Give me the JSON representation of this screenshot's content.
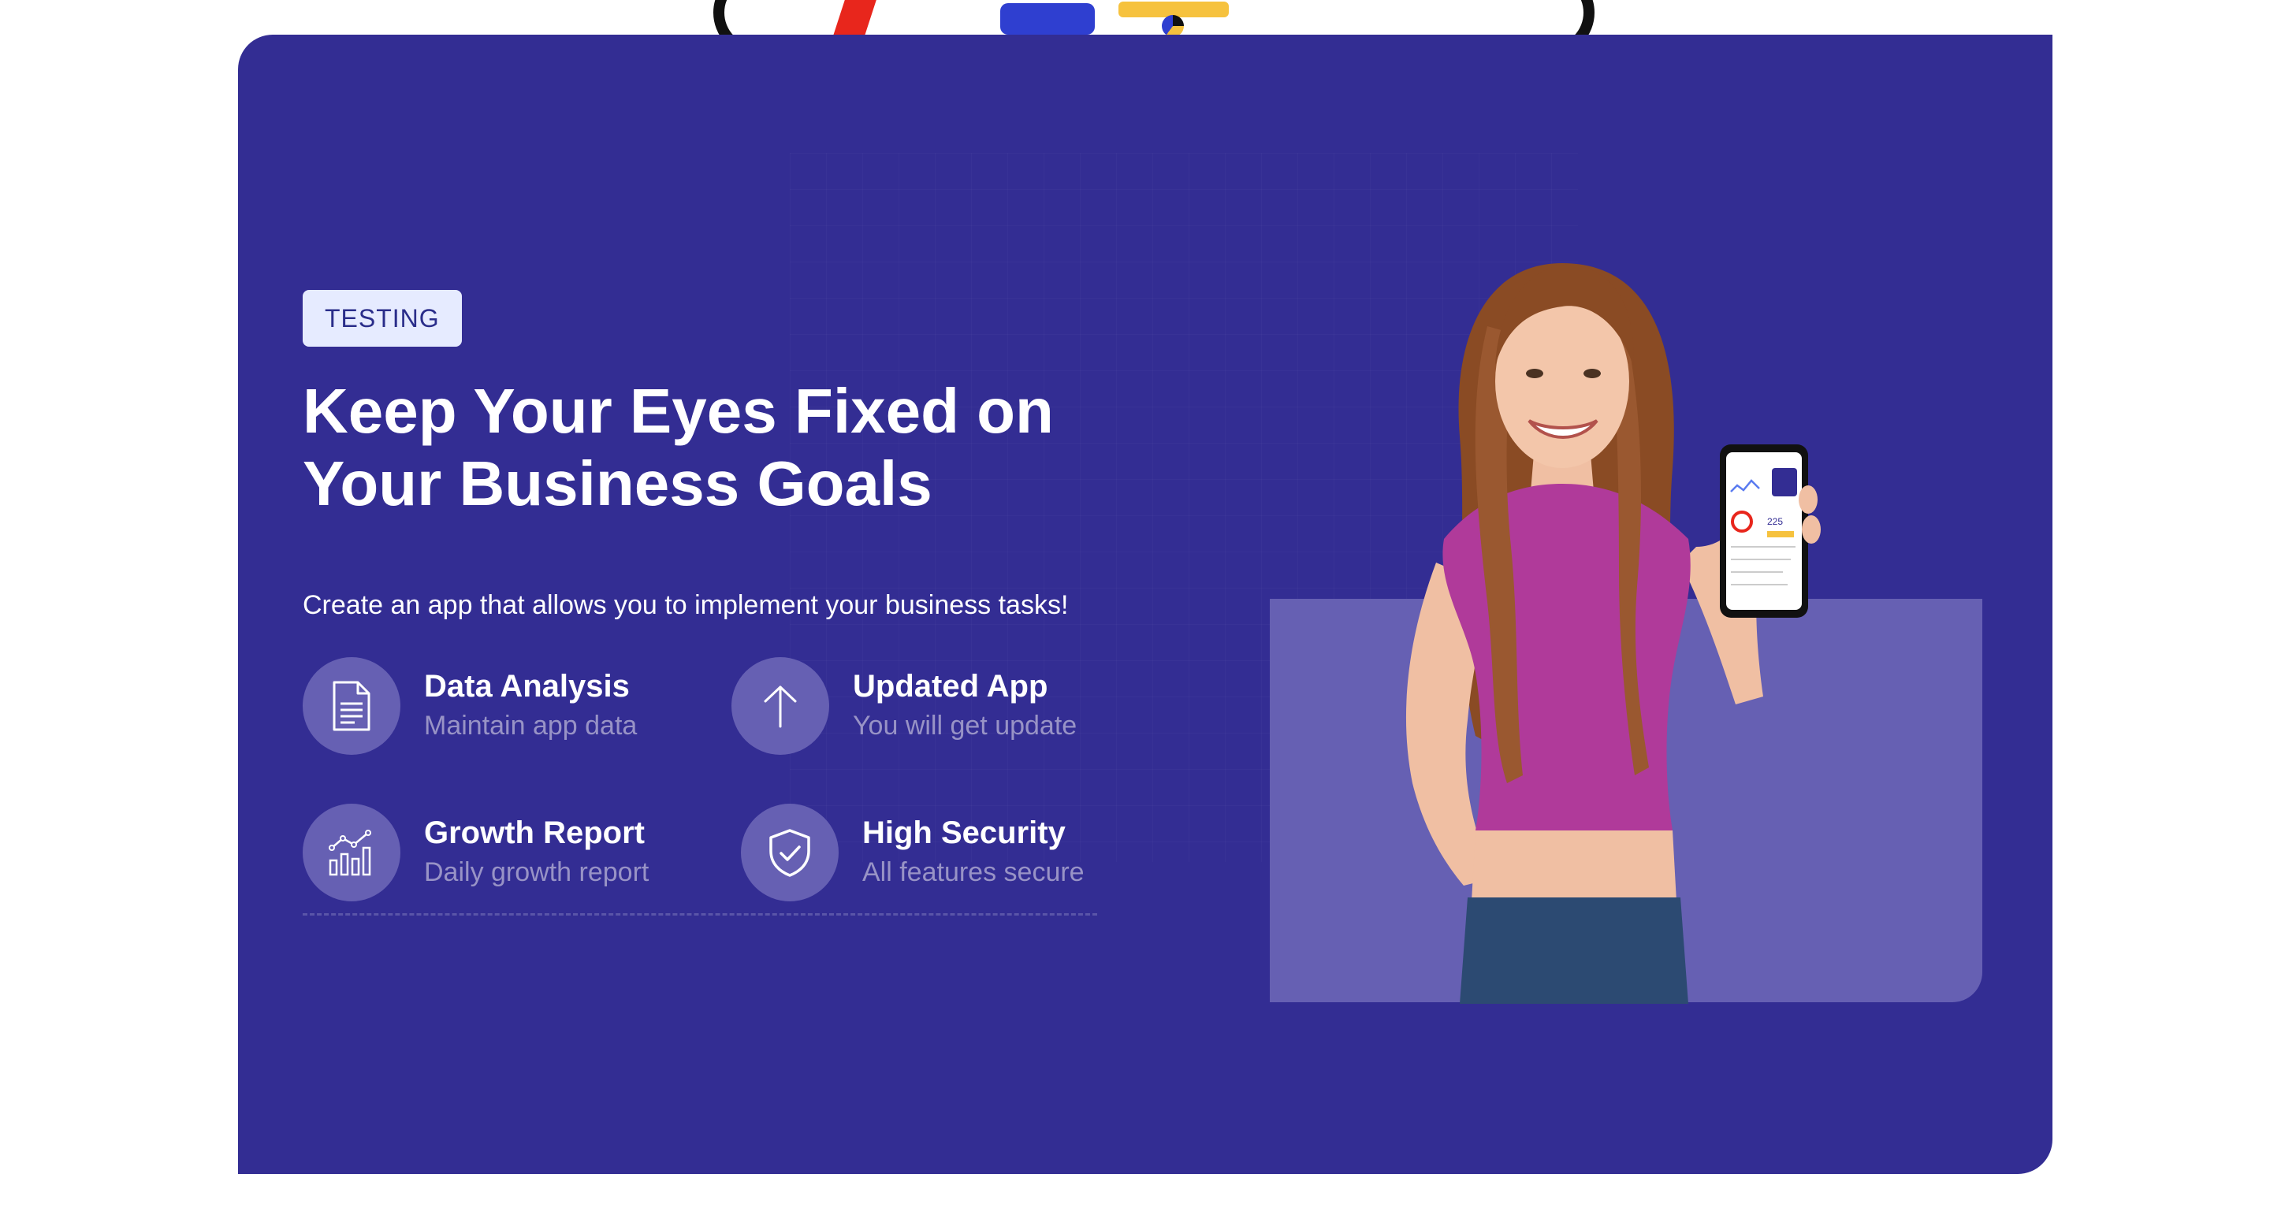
{
  "badge": {
    "label": "TESTING"
  },
  "hero": {
    "headline_line1": "Keep Your Eyes Fixed on",
    "headline_line2": "Your Business Goals",
    "subtext": "Create an app that allows you to implement your business tasks!"
  },
  "features": [
    {
      "title": "Data Analysis",
      "desc": "Maintain app data",
      "icon": "document-icon"
    },
    {
      "title": "Updated App",
      "desc": "You will get update",
      "icon": "arrow-up-icon"
    },
    {
      "title": "Growth Report",
      "desc": "Daily growth report",
      "icon": "growth-chart-icon"
    },
    {
      "title": "High Security",
      "desc": "All features secure",
      "icon": "shield-check-icon"
    }
  ],
  "phone_screen": {
    "metric": "225"
  },
  "colors": {
    "panel": "#332d93",
    "icon_circle": "#6660b3",
    "badge_bg": "#e6ebff",
    "badge_text": "#2a2d8a",
    "muted_text": "#9893c6"
  }
}
